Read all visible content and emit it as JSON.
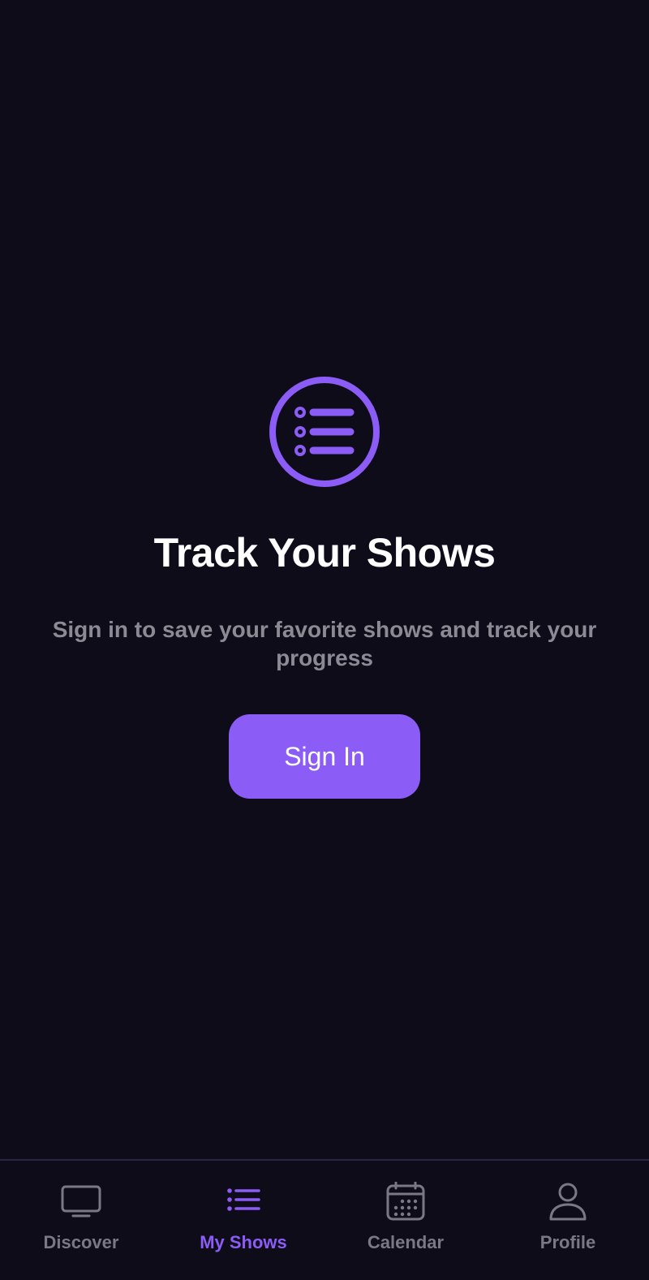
{
  "colors": {
    "background": "#0f0c1a",
    "accent": "#8b5cf6",
    "title": "#ffffff",
    "subtitle": "#8c8b93",
    "tab_inactive": "#7a7983",
    "divider": "#2a2540"
  },
  "empty_state": {
    "icon": "list-circle-icon",
    "title": "Track Your Shows",
    "subtitle": "Sign in to save your favorite shows and track your progress",
    "button_label": "Sign In"
  },
  "tabbar": {
    "active": "my-shows",
    "tabs": [
      {
        "id": "discover",
        "label": "Discover",
        "icon": "tv-icon"
      },
      {
        "id": "my-shows",
        "label": "My Shows",
        "icon": "list-icon"
      },
      {
        "id": "calendar",
        "label": "Calendar",
        "icon": "calendar-icon"
      },
      {
        "id": "profile",
        "label": "Profile",
        "icon": "person-icon"
      }
    ]
  }
}
